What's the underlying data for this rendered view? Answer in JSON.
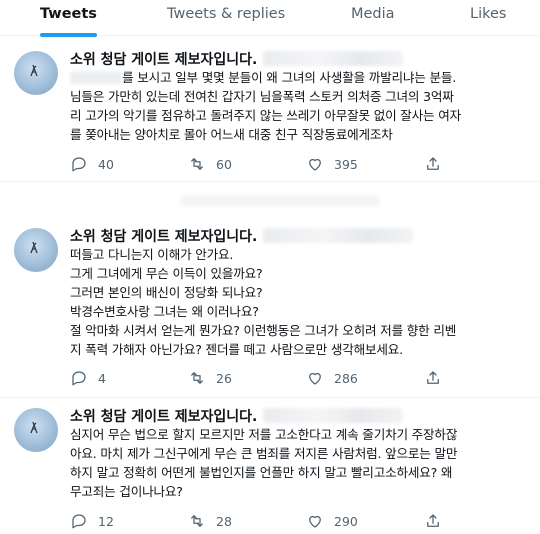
{
  "tabs": [
    {
      "label": "Tweets",
      "active": true
    },
    {
      "label": "Tweets & replies",
      "active": false
    },
    {
      "label": "Media",
      "active": false
    },
    {
      "label": "Likes",
      "active": false
    }
  ],
  "accent_color": "#1d9bf0",
  "tweets": [
    {
      "name": "소위 청담 게이트 제보자입니다.",
      "lines": [
        "를 보시고 일부 몇몇 분들이 왜 그녀의 사생활을 까발리냐는 분들.",
        "님들은 가만히 있는데 전여친 갑자기 님을폭력 스토커 의처증 그녀의 3억짜",
        "리 고가의 악기를 점유하고 돌려주지 않는 쓰레기 아무잘못 없이 잘사는 여자",
        "를 쫒아내는 양아치로 몰아 어느새 대중 친구 직장동료에게조차"
      ],
      "stats": {
        "replies": "40",
        "retweets": "60",
        "likes": "395"
      }
    },
    {
      "name": "소위 청담 게이트 제보자입니다.",
      "lines": [
        "떠들고 다니는지 이해가 안가요.",
        "그게 그녀에게 무슨 이득이 있을까요?",
        "그러면 본인의 배신이 정당화 되나요?",
        "박경수변호사랑 그녀는 왜 이러나요?",
        "절 악마화 시켜서 얻는게 뭔가요? 이런행동은 그녀가 오히려 저를 향한 리벤",
        "지 폭력 가해자 아닌가요? 젠더를 떼고 사람으로만 생각해보세요."
      ],
      "stats": {
        "replies": "4",
        "retweets": "26",
        "likes": "286"
      }
    },
    {
      "name": "소위 청담 게이트 제보자입니다.",
      "lines": [
        "심지어 무슨 법으로 할지 모르지만 저를 고소한다고 계속 줄기차기 주장하잖",
        "아요. 마치 제가 그신구에게 무슨 큰 범죄를 저지른 사람처럼. 앞으로는 말만",
        "하지 말고 정확히 어떤게 불법인지를  언플만 하지 말고 빨리고소하세요? 왜",
        "무고죄는 겁이나나요?"
      ],
      "stats": {
        "replies": "12",
        "retweets": "28",
        "likes": "290"
      }
    }
  ]
}
